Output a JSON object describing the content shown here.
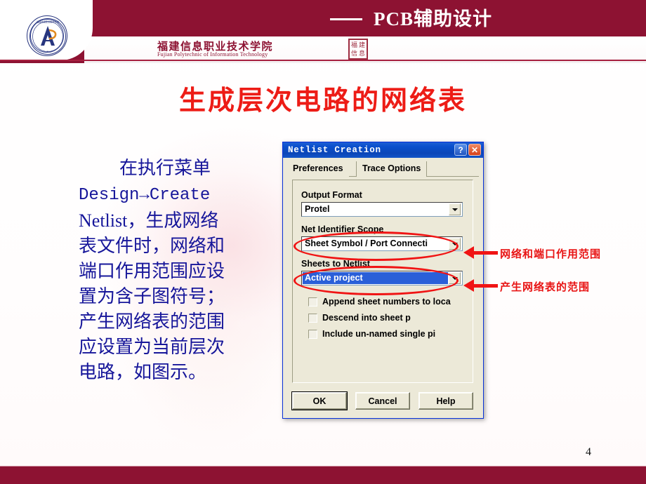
{
  "header": {
    "title": "PCB辅助设计",
    "dash": "——",
    "school_cn": "福建信息职业技术学院",
    "school_en": "Fujian Polytechnic of Information Technology",
    "stamp_chars": [
      "福",
      "建",
      "信",
      "息"
    ],
    "logo_letter": "A",
    "bar_color": "#8d1232"
  },
  "page_title": "生成层次电路的网络表",
  "body": {
    "line1": "在执行菜单",
    "line2": "Design→Create",
    "line3": "Netlist，生成网络",
    "line4": "表文件时，网络和",
    "line5": "端口作用范围应设",
    "line6": "置为含子图符号；",
    "line7": "产生网络表的范围",
    "line8": "应设置为当前层次",
    "line9": "电路，如图示。",
    "text_color": "#16169a"
  },
  "dialog": {
    "title": "Netlist Creation",
    "help_icon": "?",
    "close_icon": "✕",
    "tabs": [
      {
        "label": "Preferences",
        "active": true
      },
      {
        "label": "Trace Options",
        "active": false
      }
    ],
    "fields": [
      {
        "label": "Output Format",
        "value": "Protel",
        "selected": false
      },
      {
        "label": "Net Identifier Scope",
        "value": "Sheet Symbol / Port Connecti",
        "selected": false
      },
      {
        "label": "Sheets to Netlist",
        "value": "Active project",
        "selected": true
      }
    ],
    "checkboxes": [
      {
        "label": "Append sheet numbers to loca",
        "checked": false
      },
      {
        "label": "Descend into sheet p",
        "checked": false
      },
      {
        "label": "Include un-named single pi",
        "checked": false
      }
    ],
    "buttons": [
      {
        "label": "OK",
        "default": true
      },
      {
        "label": "Cancel",
        "default": false
      },
      {
        "label": "Help",
        "default": false
      }
    ]
  },
  "annotations": [
    {
      "text": "网络和端口作用范围",
      "target": "Net Identifier Scope",
      "color": "#e81414"
    },
    {
      "text": "产生网络表的范围",
      "target": "Sheets to Netlist",
      "color": "#e81414"
    }
  ],
  "page_number": "4"
}
